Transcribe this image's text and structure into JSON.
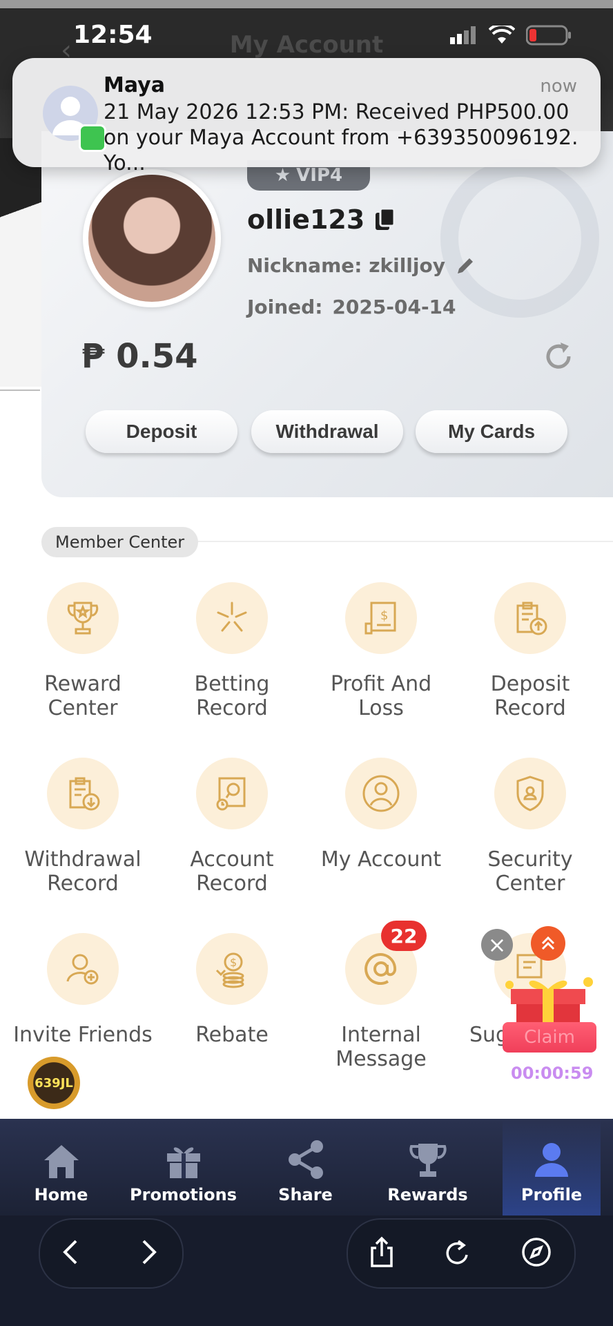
{
  "status_bar": {
    "time": "12:54"
  },
  "header": {
    "title": "My Account"
  },
  "notification": {
    "app": "Maya",
    "time": "now",
    "body": "21 May 2026 12:53 PM: Received PHP500.00 on your Maya Account from +639350096192. Yo..."
  },
  "profile": {
    "vip": "VIP4",
    "username": "ollie123",
    "nickname": "Nickname: zkilljoy",
    "joined_label": "Joined:",
    "joined_date": "2025-04-14",
    "balance": "₱ 0.54"
  },
  "actions": {
    "deposit": "Deposit",
    "withdrawal": "Withdrawal",
    "my_cards": "My Cards"
  },
  "member_center": {
    "label": "Member Center",
    "items": [
      {
        "label": "Reward Center",
        "icon": "trophy-icon"
      },
      {
        "label": "Betting Record",
        "icon": "burst-icon"
      },
      {
        "label": "Profit And Loss",
        "icon": "receipt-icon"
      },
      {
        "label": "Deposit Record",
        "icon": "clipboard-upload-icon"
      },
      {
        "label": "Withdrawal Record",
        "icon": "clipboard-download-icon"
      },
      {
        "label": "Account Record",
        "icon": "account-record-icon"
      },
      {
        "label": "My Account",
        "icon": "user-circle-icon"
      },
      {
        "label": "Security Center",
        "icon": "shield-user-icon"
      },
      {
        "label": "Invite Friends",
        "icon": "user-plus-icon"
      },
      {
        "label": "Rebate",
        "icon": "coins-icon"
      },
      {
        "label": "Internal Message",
        "icon": "at-icon"
      },
      {
        "label": "Sug",
        "icon": "suggestion-icon"
      }
    ],
    "message_badge": "22"
  },
  "floating": {
    "claim": "Claim",
    "timer": "00:00:59",
    "logo": "639JL"
  },
  "nav": [
    {
      "label": "Home",
      "icon": "home-icon"
    },
    {
      "label": "Promotions",
      "icon": "gift-icon"
    },
    {
      "label": "Share",
      "icon": "share-icon"
    },
    {
      "label": "Rewards",
      "icon": "trophy-icon"
    },
    {
      "label": "Profile",
      "icon": "profile-icon"
    }
  ],
  "colors": {
    "accent": "#d8a854",
    "icon_bg": "#fcefd9",
    "nav_bg": "#1f263b",
    "badge": "#e8312f"
  }
}
